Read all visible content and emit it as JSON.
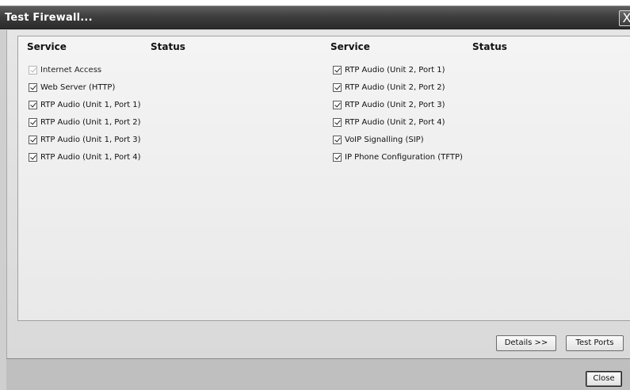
{
  "window": {
    "title": "Test Firewall...",
    "close_glyph": "X"
  },
  "columns": {
    "left": {
      "service": "Service",
      "status": "Status"
    },
    "right": {
      "service": "Service",
      "status": "Status"
    }
  },
  "services_left": [
    {
      "label": "Internet Access",
      "checked": true,
      "enabled": false
    },
    {
      "label": "Web Server (HTTP)",
      "checked": true,
      "enabled": true
    },
    {
      "label": "RTP Audio (Unit 1, Port 1)",
      "checked": true,
      "enabled": true
    },
    {
      "label": "RTP Audio (Unit 1, Port 2)",
      "checked": true,
      "enabled": true
    },
    {
      "label": "RTP Audio (Unit 1, Port 3)",
      "checked": true,
      "enabled": true
    },
    {
      "label": "RTP Audio (Unit 1, Port 4)",
      "checked": true,
      "enabled": true
    }
  ],
  "services_right": [
    {
      "label": "RTP Audio (Unit 2, Port 1)",
      "checked": true,
      "enabled": true
    },
    {
      "label": "RTP Audio (Unit 2, Port 2)",
      "checked": true,
      "enabled": true
    },
    {
      "label": "RTP Audio (Unit 2, Port 3)",
      "checked": true,
      "enabled": true
    },
    {
      "label": "RTP Audio (Unit 2, Port 4)",
      "checked": true,
      "enabled": true
    },
    {
      "label": "VoIP Signalling (SIP)",
      "checked": true,
      "enabled": true
    },
    {
      "label": "IP Phone Configuration (TFTP)",
      "checked": true,
      "enabled": true
    }
  ],
  "buttons": {
    "details": "Details >>",
    "test_ports": "Test Ports",
    "close": "Close"
  }
}
